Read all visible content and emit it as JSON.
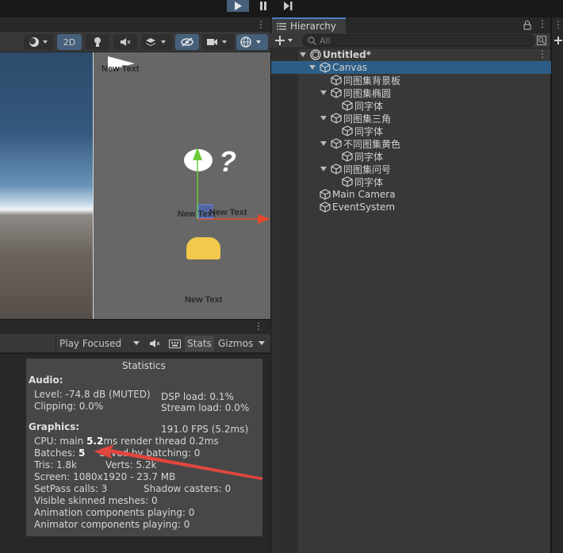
{
  "colors": {
    "accent_blue": "#4a7ec6",
    "selection": "#2c5d87",
    "annotation_red": "#e0463e",
    "button_yellow": "#f2c94c"
  },
  "playbar": {
    "buttons": [
      "play-icon",
      "pause-icon",
      "step-icon"
    ]
  },
  "scene": {
    "toolbar": {
      "mode_2d": "2D"
    },
    "texts": [
      "New Text",
      "New Text",
      "New Text",
      "New Text"
    ],
    "question_mark": "?"
  },
  "game": {
    "play_mode": "Play Focused",
    "stats_label": "Stats",
    "gizmos_label": "Gizmos"
  },
  "stats": {
    "title": "Statistics",
    "audio_header": "Audio:",
    "level": "Level: -74.8 dB (MUTED)",
    "clipping": "Clipping: 0.0%",
    "dsp_load": "DSP load: 0.1%",
    "stream_load": "Stream load: 0.0%",
    "graphics_header": "Graphics:",
    "fps": "191.0 FPS (5.2ms)",
    "cpu_prefix": "CPU: main ",
    "cpu_main": "5.2",
    "cpu_suffix": "ms  render thread 0.2ms",
    "batches_prefix": "Batches: ",
    "batches_value": "5",
    "saved_batching": "Saved by batching: 0",
    "tris": "Tris: 1.8k",
    "verts": "Verts: 5.2k",
    "screen": "Screen: 1080x1920 - 23.7 MB",
    "setpass": "SetPass calls: 3",
    "shadow_casters": "Shadow casters: 0",
    "skinned_meshes": "Visible skinned meshes: 0",
    "animation_components": "Animation components playing: 0",
    "animator_components": "Animator components playing: 0"
  },
  "hierarchy": {
    "tab_label": "Hierarchy",
    "search_placeholder": "All",
    "scene_name": "Untitled*",
    "items": [
      {
        "label": "Canvas",
        "depth": 1,
        "expanded": true,
        "selected": true
      },
      {
        "label": "同图集背景板",
        "depth": 2,
        "expanded": false
      },
      {
        "label": "同图集椭圆",
        "depth": 2,
        "expanded": true
      },
      {
        "label": "同字体",
        "depth": 3,
        "expanded": false
      },
      {
        "label": "同图集三角",
        "depth": 2,
        "expanded": true
      },
      {
        "label": "同字体",
        "depth": 3,
        "expanded": false
      },
      {
        "label": "不同图集黄色",
        "depth": 2,
        "expanded": true
      },
      {
        "label": "同字体",
        "depth": 3,
        "expanded": false
      },
      {
        "label": "同图集问号",
        "depth": 2,
        "expanded": true
      },
      {
        "label": "同字体",
        "depth": 3,
        "expanded": false
      },
      {
        "label": "Main Camera",
        "depth": 1,
        "expanded": false
      },
      {
        "label": "EventSystem",
        "depth": 1,
        "expanded": false
      }
    ]
  }
}
